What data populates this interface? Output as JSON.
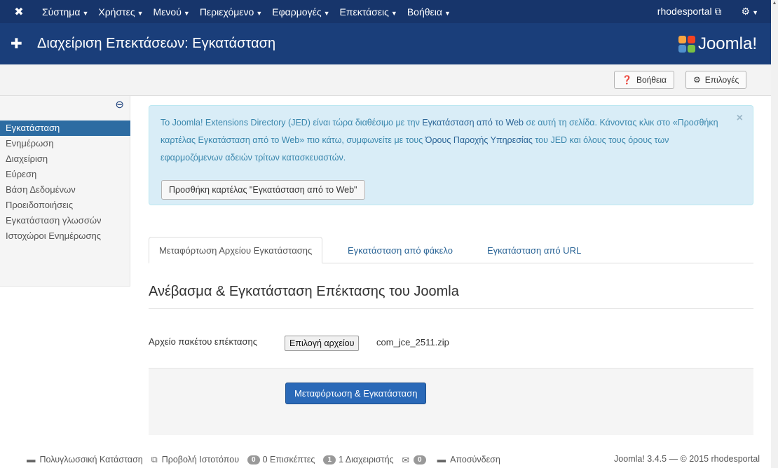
{
  "topnav": {
    "logo_icon": "joomla-icon",
    "menu": [
      "Σύστημα",
      "Χρήστες",
      "Μενού",
      "Περιεχόμενο",
      "Εφαρμογές",
      "Επεκτάσεις",
      "Βοήθεια"
    ],
    "site_label": "rhodesportal"
  },
  "header": {
    "title": "Διαχείριση Επεκτάσεων: Εγκατάσταση",
    "brand": "Joomla!"
  },
  "toolbar": {
    "help": "Βοήθεια",
    "options": "Επιλογές"
  },
  "sidebar": {
    "items": [
      "Εγκατάσταση",
      "Ενημέρωση",
      "Διαχείριση",
      "Εύρεση",
      "Βάση Δεδομένων",
      "Προειδοποιήσεις",
      "Εγκατάσταση γλωσσών",
      "Ιστοχώροι Ενημέρωσης"
    ],
    "active_index": 0
  },
  "alert": {
    "p1": "Το Joomla! Extensions Directory (JED) είναι τώρα διαθέσιμο με την ",
    "link1": "Εγκατάσταση από το Web",
    "p2": " σε αυτή τη σελίδα.  Κάνοντας κλικ στο «Προσθήκη καρτέλας Εγκατάσταση από το Web» πιο κάτω, συμφωνείτε με τους ",
    "link2": "Όρους Παροχής Υπηρεσίας",
    "p3": " του JED και όλους τους όρους των εφαρμοζόμενων αδειών τρίτων κατασκευαστών.",
    "button": "Προσθήκη καρτέλας \"Εγκατάσταση από το Web\"",
    "close": "×"
  },
  "tabs": [
    "Μεταφόρτωση Αρχείου Εγκατάστασης",
    "Εγκατάσταση από φάκελο",
    "Εγκατάσταση από URL"
  ],
  "upload": {
    "section_title": "Ανέβασμα & Εγκατάσταση Επέκτασης του Joomla",
    "field_label": "Αρχείο πακέτου επέκτασης",
    "file_button": "Επιλογή αρχείου",
    "file_name": "com_jce_2511.zip",
    "submit": "Μεταφόρτωση & Εγκατάσταση"
  },
  "statusbar": {
    "multilang": "Πολυγλωσσική Κατάσταση",
    "view_site": "Προβολή Ιστοτόπου",
    "visitors_count": "0",
    "visitors_label": "0 Επισκέπτες",
    "admins_count": "1",
    "admins_label": "1 Διαχειριστής",
    "messages_count": "0",
    "logout": "Αποσύνδεση",
    "copyright": "Joomla! 3.4.5 — © 2015 rhodesportal"
  },
  "colors": {
    "nav_bg": "#17356b",
    "header_bg": "#1a3e7a",
    "primary": "#2a69b8",
    "sidebar_active": "#2d6ca2",
    "alert_bg": "#d9edf7"
  }
}
